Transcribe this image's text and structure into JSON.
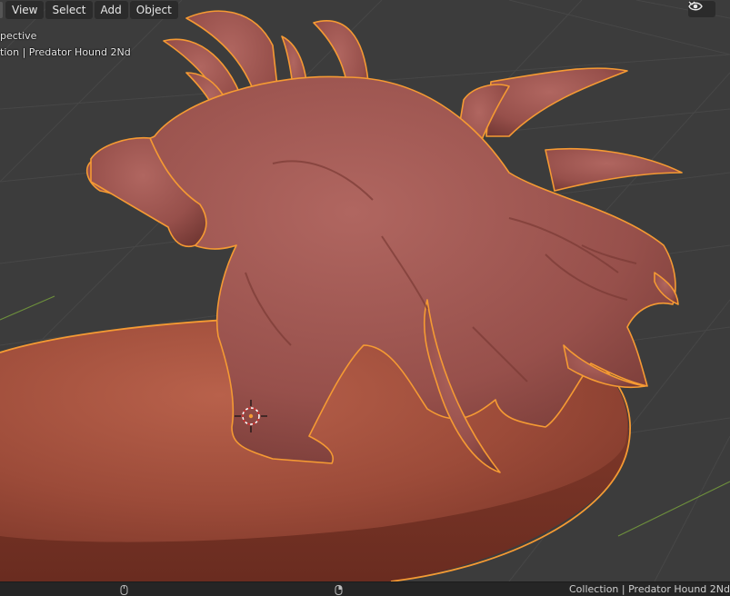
{
  "header": {
    "menu": [
      {
        "id": "view",
        "label": "View"
      },
      {
        "id": "select",
        "label": "Select"
      },
      {
        "id": "add",
        "label": "Add"
      },
      {
        "id": "object",
        "label": "Object"
      }
    ],
    "visibility_icon": "eye-icon"
  },
  "viewport": {
    "perspective_label": "pective",
    "collection_label": "tion | Predator Hound 2Nd"
  },
  "status_bar": {
    "text": "Collection | Predator Hound 2Nd"
  },
  "colors": {
    "viewport_bg": "#3c3c3c",
    "grid_line": "#454545",
    "base_surface": "#9a4a38",
    "model_surface": "#9a5049",
    "selection_outline": "#f59a33"
  }
}
